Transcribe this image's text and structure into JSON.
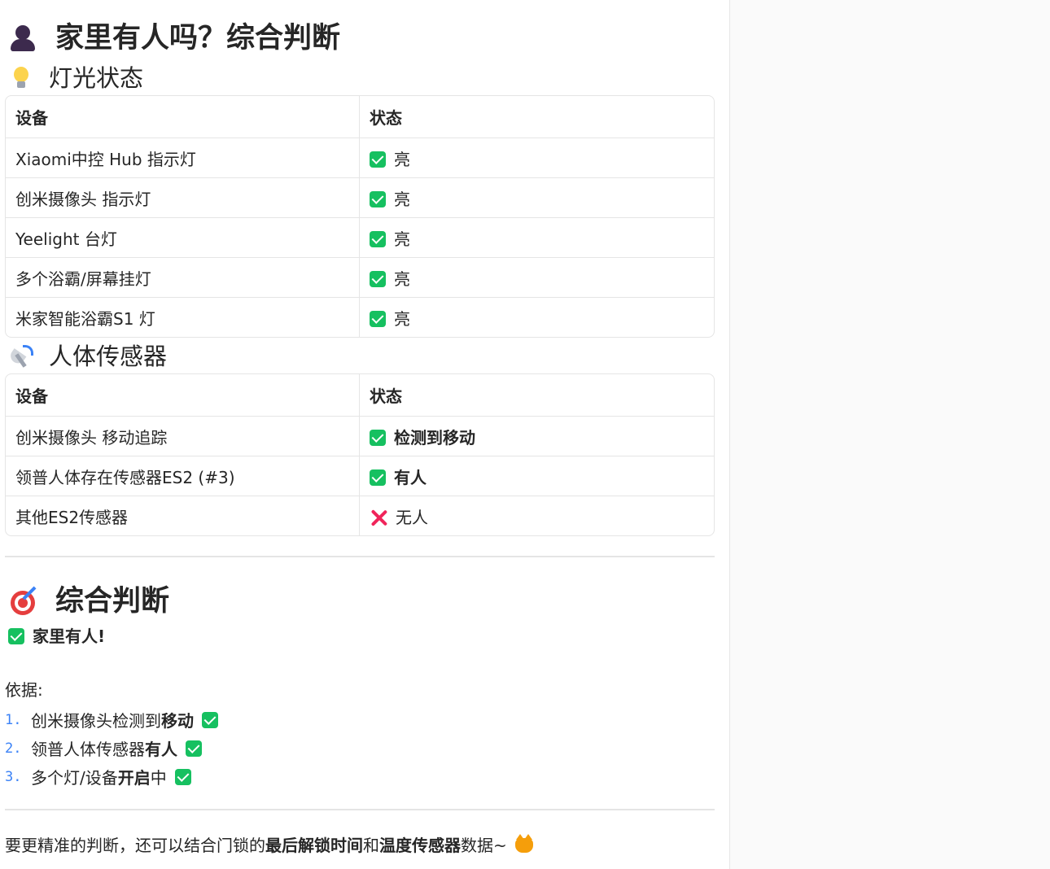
{
  "title": "家里有人吗？综合判断",
  "lights": {
    "heading": "灯光状态",
    "headers": [
      "设备",
      "状态"
    ],
    "rows": [
      {
        "device": "Xiaomi中控 Hub 指示灯",
        "status": "亮"
      },
      {
        "device": "创米摄像头 指示灯",
        "status": "亮"
      },
      {
        "device": "Yeelight 台灯",
        "status": "亮"
      },
      {
        "device": "多个浴霸/屏幕挂灯",
        "status": "亮"
      },
      {
        "device": "米家智能浴霸S1 灯",
        "status": "亮"
      }
    ]
  },
  "sensors": {
    "heading": "人体传感器",
    "headers": [
      "设备",
      "状态"
    ],
    "rows": [
      {
        "device": "创米摄像头 移动追踪",
        "status": "检测到移动"
      },
      {
        "device": "领普人体存在传感器ES2 (#3)",
        "status": "有人"
      },
      {
        "device": "其他ES2传感器",
        "status": "无人"
      }
    ]
  },
  "conclusion": {
    "heading": "综合判断",
    "verdict": "家里有人!",
    "basis_label": "依据:",
    "items": [
      {
        "num": "1.",
        "pre": "创米摄像头检测到",
        "bold": "移动",
        "post": ""
      },
      {
        "num": "2.",
        "pre": "领普人体传感器",
        "bold": "有人",
        "post": ""
      },
      {
        "num": "3.",
        "pre": "多个灯/设备",
        "bold": "开启",
        "post": "中"
      }
    ]
  },
  "footer": {
    "part1": "要更精准的判断，还可以结合门锁的",
    "bold1": "最后解锁时间",
    "part2": "和",
    "bold2": "温度传感器",
    "part3": "数据~"
  },
  "colors": {
    "check": "#16c060",
    "cross": "#f0245a",
    "list_number": "#3b82f6"
  }
}
